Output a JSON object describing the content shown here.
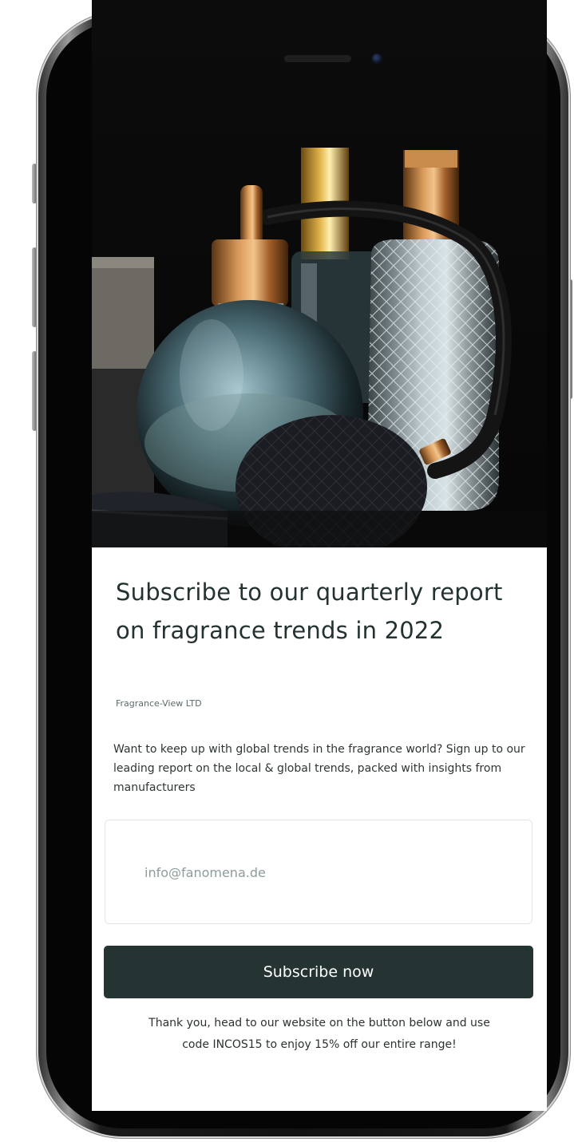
{
  "hero": {
    "image_description_icon": "perfume-bottles-image"
  },
  "content": {
    "title": "Subscribe to our quarterly report on fragrance trends in 2022",
    "company": "Fragrance-View LTD",
    "description": "Want to keep up with global trends in the fragrance world? Sign up to our leading report on the local & global trends, packed with insights from manufacturers",
    "email": {
      "placeholder": "info@fanomena.de",
      "value": ""
    },
    "subscribe_label": "Subscribe now",
    "thanks": "Thank you, head to our website on the button below and use code INCOS15 to enjoy 15% off our entire range!"
  },
  "colors": {
    "button_bg": "#253333",
    "title_text": "#243232",
    "screen_bg": "#ffffff",
    "frame": "#111111"
  }
}
